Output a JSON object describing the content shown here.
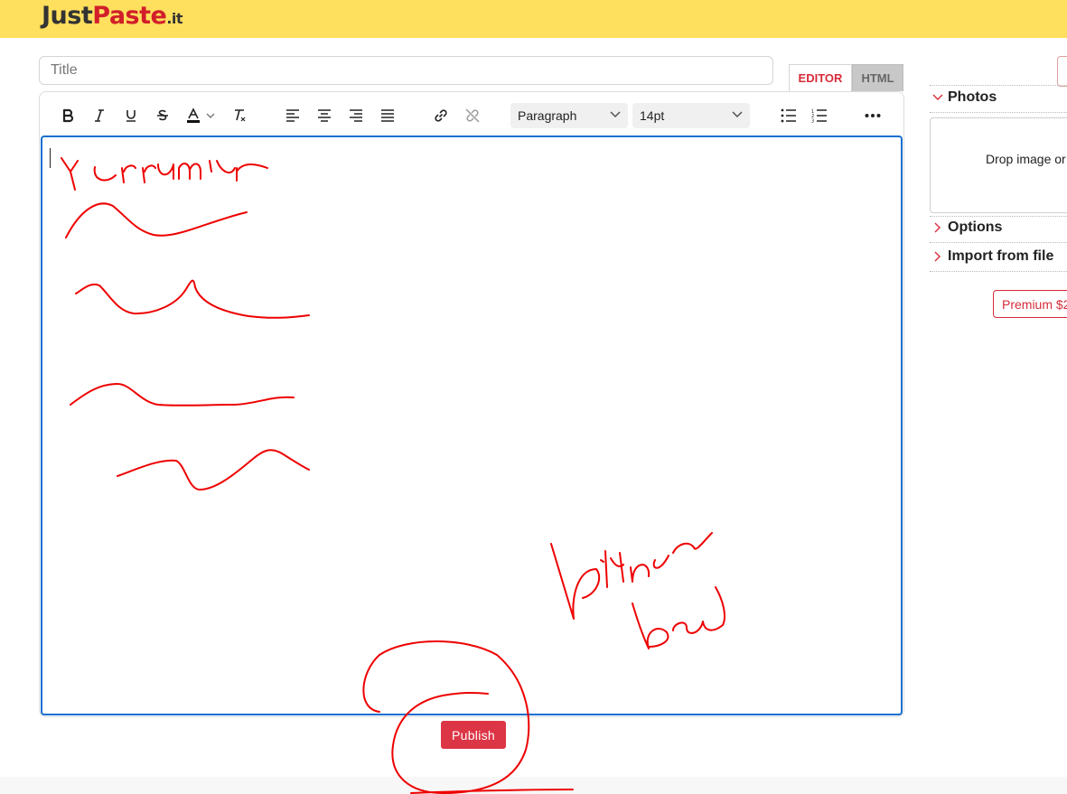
{
  "header": {
    "logo": {
      "just": "Just",
      "paste": "Paste",
      "tld": ".it"
    }
  },
  "title_input": {
    "placeholder": "Title",
    "value": ""
  },
  "mode_tabs": {
    "editor": "EDITOR",
    "html": "HTML",
    "active": "EDITOR"
  },
  "toolbar": {
    "block_format": "Paragraph",
    "font_size": "14pt",
    "icons": [
      "bold-icon",
      "italic-icon",
      "underline-icon",
      "strikethrough-icon",
      "text-color-icon",
      "clear-formatting-icon",
      "align-left-icon",
      "align-center-icon",
      "align-right-icon",
      "justify-icon",
      "link-icon",
      "unlink-icon",
      "bullet-list-icon",
      "numbered-list-icon",
      "more-icon"
    ]
  },
  "publish_button": {
    "label": "Publish"
  },
  "sidebar": {
    "photos": {
      "label": "Photos",
      "expanded": true
    },
    "dropzone_text": "Drop image or",
    "options": {
      "label": "Options",
      "expanded": false
    },
    "import": {
      "label": "Import from file",
      "expanded": false
    },
    "premium_label": "Premium $2"
  },
  "colors": {
    "header_bg": "#ffdf5e",
    "brand_red": "#d11f2a",
    "publish_bg": "#dc3545",
    "editor_focus_border": "#1a6fd0",
    "annotation_red": "#ee0000"
  }
}
